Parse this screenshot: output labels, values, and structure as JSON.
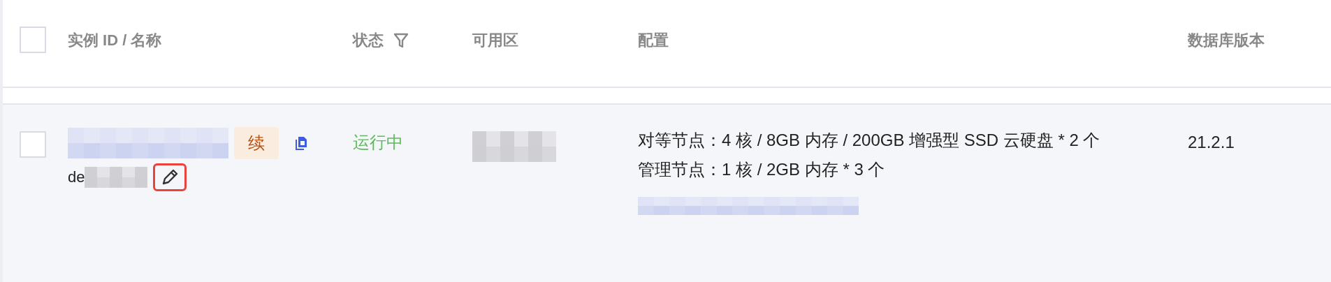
{
  "table": {
    "select_all": {
      "checked": false
    },
    "columns": [
      {
        "label": "实例 ID / 名称",
        "filter": false
      },
      {
        "label": "状态",
        "filter": true
      },
      {
        "label": "可用区",
        "filter": false
      },
      {
        "label": "配置",
        "filter": false
      },
      {
        "label": "数据库版本",
        "filter": false
      }
    ],
    "rows": [
      {
        "checked": false,
        "name_prefix": "de",
        "badge": "续",
        "edit_highlighted": true,
        "status": "运行中",
        "config": [
          "对等节点：4 核 / 8GB 内存 / 200GB 增强型 SSD 云硬盘 * 2 个",
          "管理节点：1 核 / 2GB 内存 * 3 个"
        ],
        "version": "21.2.1"
      }
    ]
  }
}
